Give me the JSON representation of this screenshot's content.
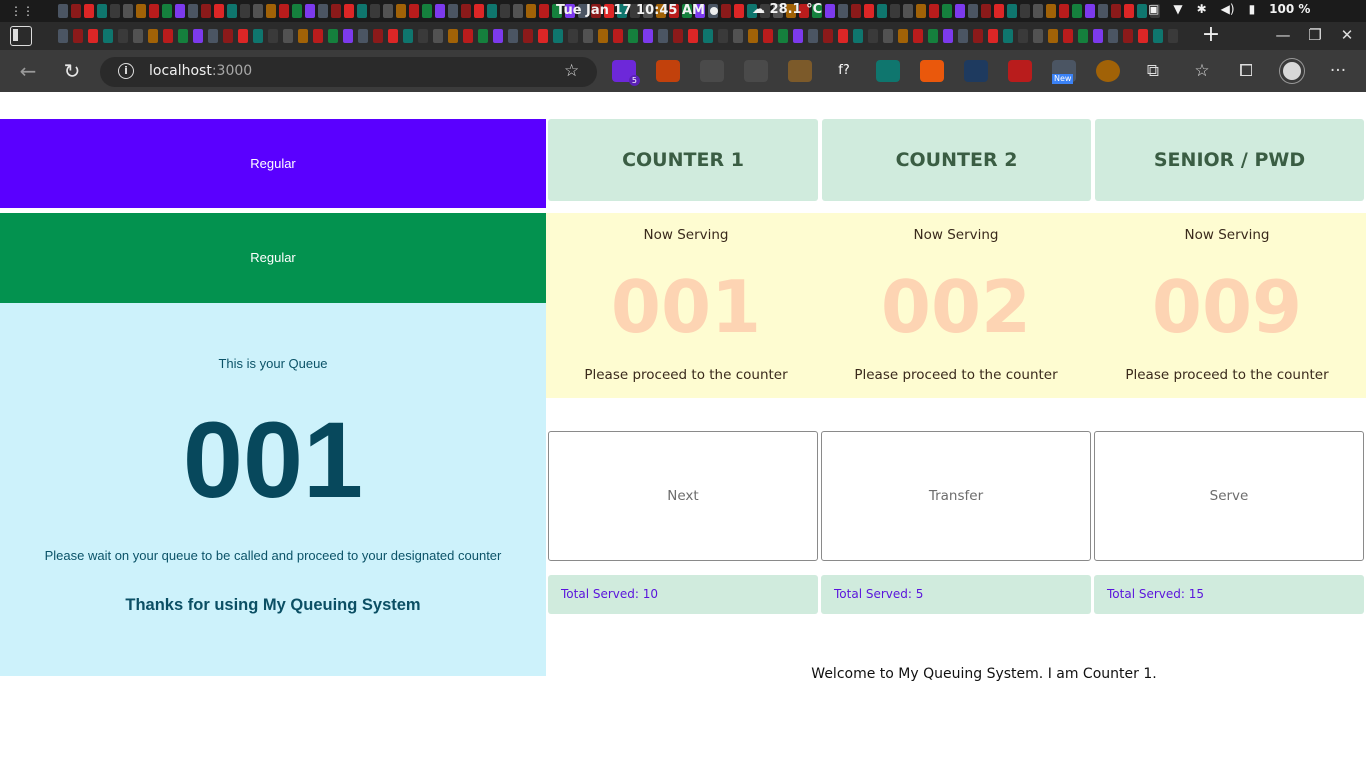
{
  "os_bar": {
    "clock": "Tue Jan 17  10:45 AM",
    "weather": "28.1 °C",
    "battery": "100 %"
  },
  "browser": {
    "address_host": "localhost",
    "address_port": ":3000",
    "ext_badge_count": "5",
    "ext_font_label": "f?",
    "ext_new_label": "New"
  },
  "queue_panel": {
    "banners": [
      "Regular",
      "Regular"
    ],
    "banner_colors": [
      "#5a00ff",
      "#03924f"
    ],
    "ticket_label": "This is your Queue",
    "ticket_number": "001",
    "instruction": "Please wait on your queue to be called and proceed to your designated counter",
    "thanks": "Thanks for using My Queuing System"
  },
  "counters": [
    {
      "title": "COUNTER 1",
      "serving_label": "Now Serving",
      "serving_number": "001",
      "instruction": "Please proceed to the counter",
      "total_served": "Total Served: 10"
    },
    {
      "title": "COUNTER 2",
      "serving_label": "Now Serving",
      "serving_number": "002",
      "instruction": "Please proceed to the counter",
      "total_served": "Total Served: 5"
    },
    {
      "title": "SENIOR / PWD",
      "serving_label": "Now Serving",
      "serving_number": "009",
      "instruction": "Please proceed to the counter",
      "total_served": "Total Served: 15"
    }
  ],
  "actions": [
    "Next",
    "Transfer",
    "Serve"
  ],
  "welcome_message": "Welcome to My Queuing System. I am Counter 1.",
  "colors": {
    "counter_header_bg": "#d0ebdd",
    "serving_band_bg": "#fefcd1",
    "serving_number": "#fdd4b3",
    "ticket_bg": "#cdf2fb",
    "total_served_text": "#5a14dc"
  }
}
